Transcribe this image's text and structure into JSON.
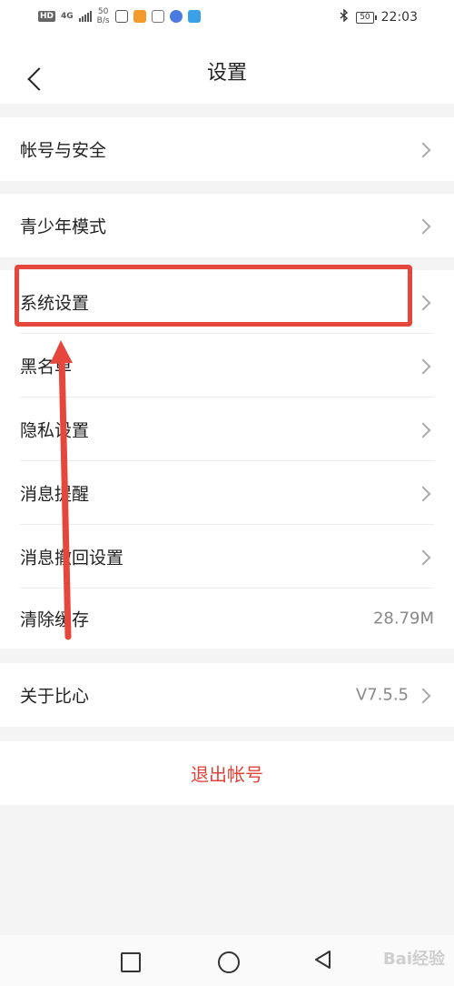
{
  "status_bar": {
    "hd": "HD",
    "network": "4G",
    "speed_value": "50",
    "speed_unit": "B/s",
    "battery": "50",
    "time": "22:03",
    "bluetooth_icon": "bluetooth-icon"
  },
  "header": {
    "title": "设置",
    "back_icon": "chevron-left-icon"
  },
  "settings": {
    "items": [
      {
        "label": "帐号与安全"
      },
      {
        "label": "青少年模式"
      },
      {
        "label": "系统设置"
      },
      {
        "label": "黑名单"
      },
      {
        "label": "隐私设置"
      },
      {
        "label": "消息提醒"
      },
      {
        "label": "消息撤回设置"
      },
      {
        "label": "清除缓存",
        "value": "28.79M"
      },
      {
        "label": "关于比心",
        "value": "V7.5.5"
      }
    ]
  },
  "logout_label": "退出帐号",
  "annotation": {
    "color": "#e5473c"
  },
  "accent_color": "#e0433a",
  "watermark": "Bai经验"
}
